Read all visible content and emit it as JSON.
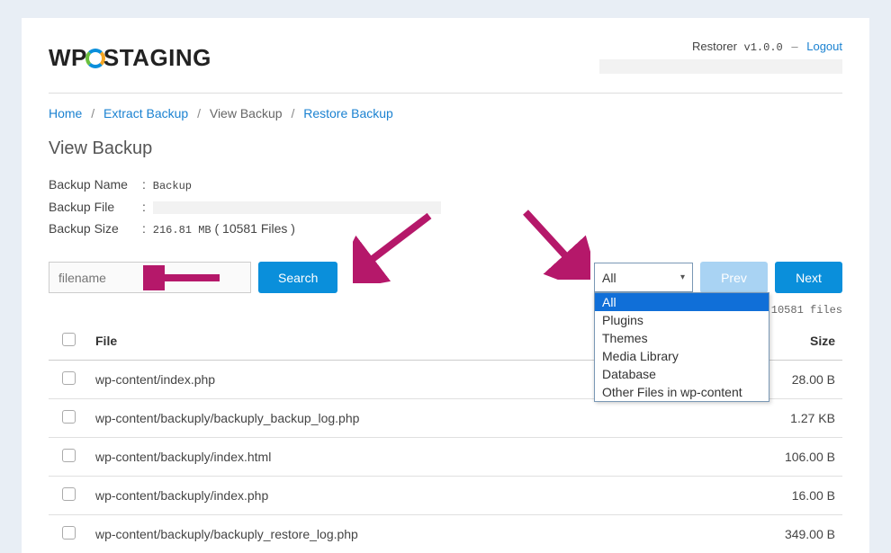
{
  "logo_pre": "WP",
  "logo_post": "STAGING",
  "header": {
    "app_label": "Restorer",
    "version": "v1.0.0",
    "logout": "Logout"
  },
  "breadcrumb": {
    "home": "Home",
    "extract": "Extract Backup",
    "view": "View Backup",
    "restore": "Restore Backup"
  },
  "page_title": "View Backup",
  "meta": {
    "name_label": "Backup Name",
    "name_value": "Backup",
    "file_label": "Backup File",
    "size_label": "Backup Size",
    "size_value": "216.81 MB",
    "size_files": "( 10581 Files )"
  },
  "toolbar": {
    "search_placeholder": "filename",
    "search_btn": "Search",
    "prev": "Prev",
    "next": "Next"
  },
  "filter": {
    "selected": "All",
    "options": [
      "All",
      "Plugins",
      "Themes",
      "Media Library",
      "Database",
      "Other Files in wp-content"
    ]
  },
  "count_text": "1/212 of 10581 files",
  "columns": {
    "file": "File",
    "size": "Size"
  },
  "rows": [
    {
      "path": "wp-content/index.php",
      "size": "28.00 B"
    },
    {
      "path": "wp-content/backuply/backuply_backup_log.php",
      "size": "1.27 KB"
    },
    {
      "path": "wp-content/backuply/index.html",
      "size": "106.00 B"
    },
    {
      "path": "wp-content/backuply/index.php",
      "size": "16.00 B"
    },
    {
      "path": "wp-content/backuply/backuply_restore_log.php",
      "size": "349.00 B"
    }
  ]
}
